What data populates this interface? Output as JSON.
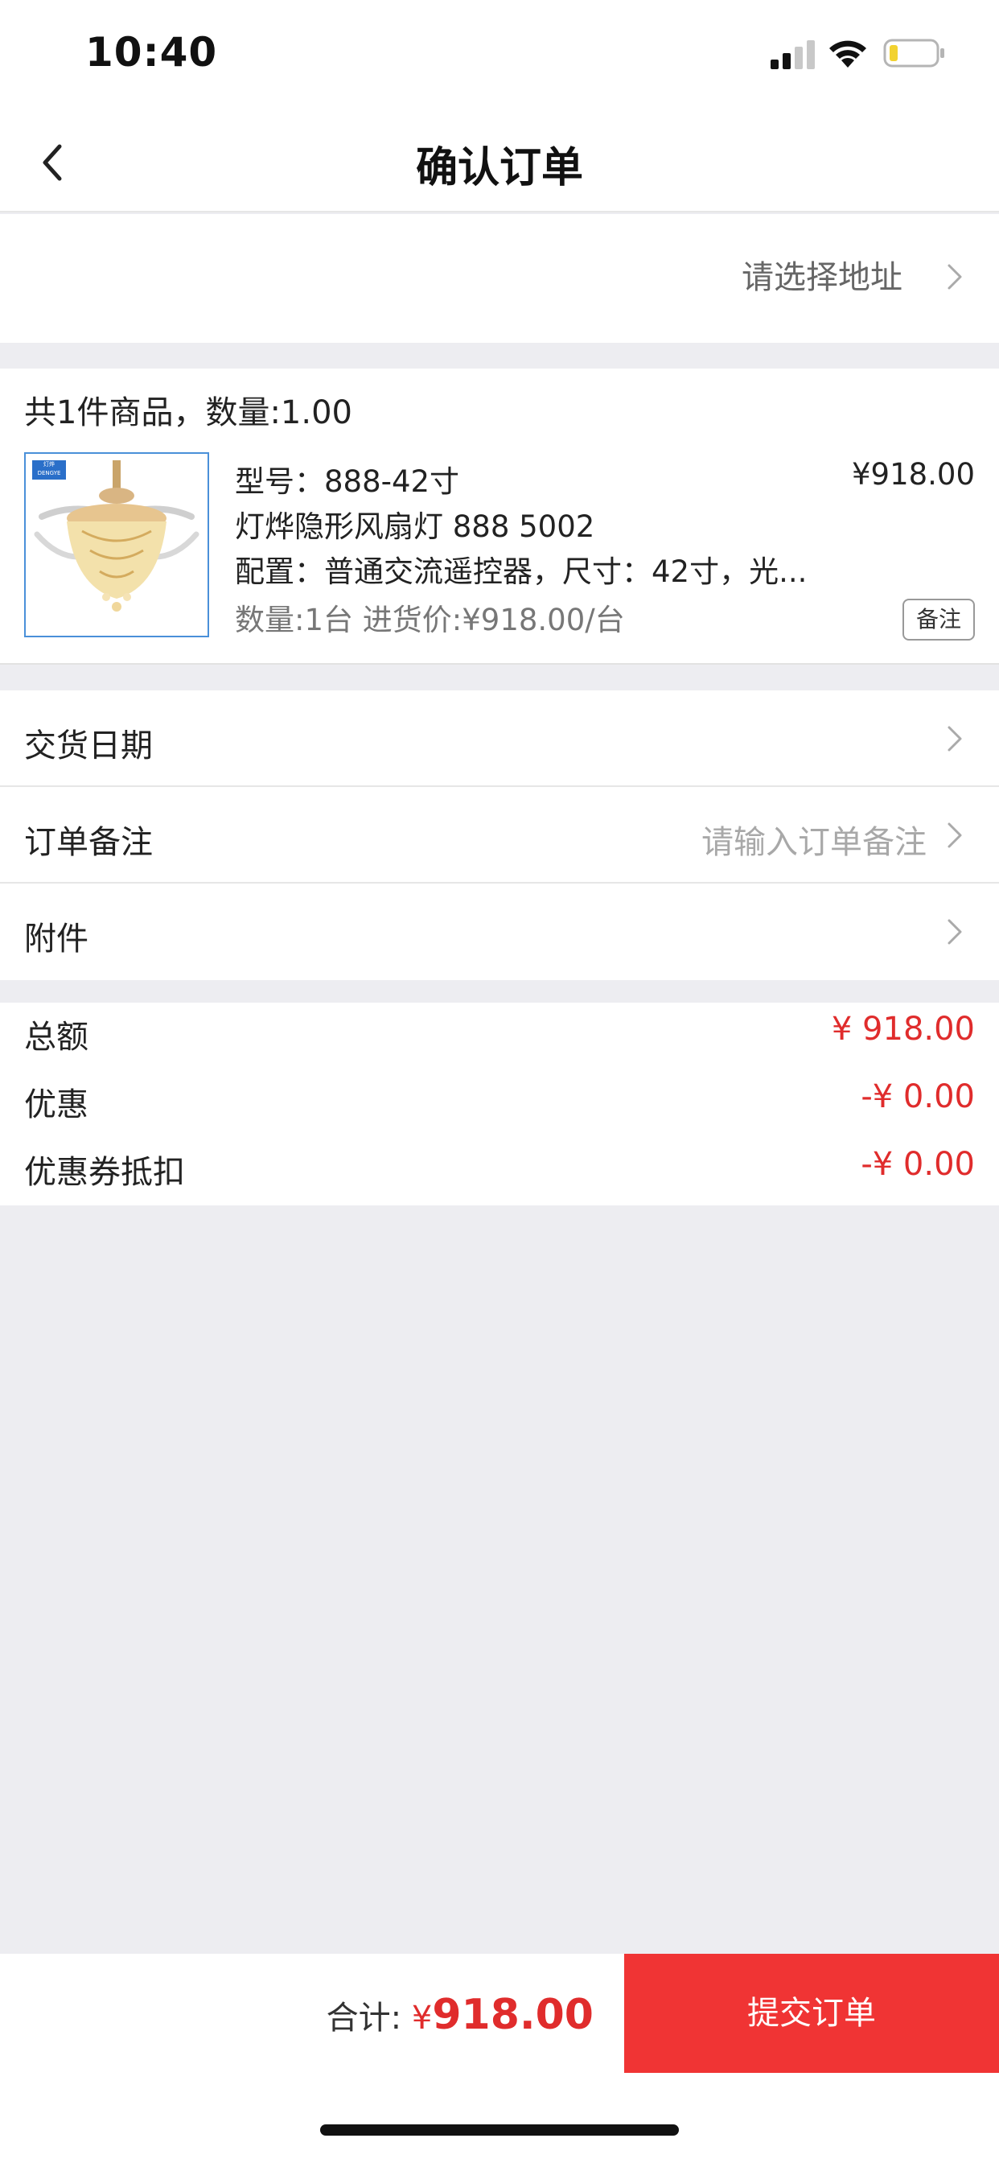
{
  "status_bar": {
    "time": "10:40"
  },
  "nav": {
    "title": "确认订单"
  },
  "address": {
    "placeholder": "请选择地址"
  },
  "order": {
    "summary": "共1件商品，数量:1.00",
    "item": {
      "model": "型号：888-42寸",
      "price": "¥918.00",
      "name": "灯烨隐形风扇灯 888 5002",
      "config": "配置：普通交流遥控器，尺寸：42寸，光...",
      "quantity": "数量:1台 进货价:¥918.00/台",
      "remark_label": "备注",
      "thumb_brand": "灯烨照明 DENGYE"
    }
  },
  "options": [
    {
      "label": "交货日期",
      "placeholder": ""
    },
    {
      "label": "订单备注",
      "placeholder": "请输入订单备注"
    },
    {
      "label": "附件",
      "placeholder": ""
    }
  ],
  "totals": [
    {
      "label": "总额",
      "value": "¥ 918.00"
    },
    {
      "label": "优惠",
      "value": "-¥ 0.00"
    },
    {
      "label": "优惠券抵扣",
      "value": "-¥ 0.00"
    }
  ],
  "footer": {
    "sum_label": "合计: ",
    "currency": "¥",
    "sum_value": "918.00",
    "submit_label": "提交订单"
  },
  "colors": {
    "accent": "#f03434",
    "price_red": "#e02c2c",
    "background": "#ededf1"
  }
}
